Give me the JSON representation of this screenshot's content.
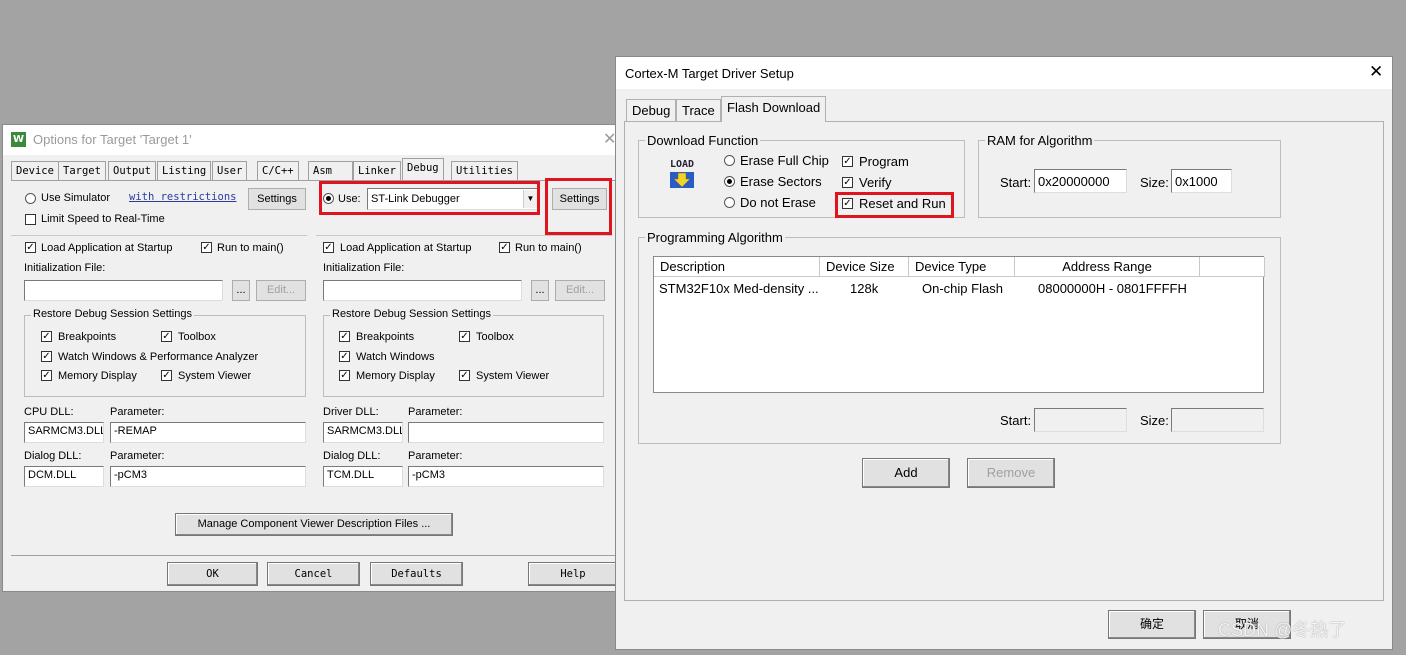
{
  "options_dialog": {
    "title": "Options for Target 'Target 1'",
    "close": "✕",
    "app_icon": "W",
    "tabs": [
      "Device",
      "Target",
      "Output",
      "Listing",
      "User",
      "C/C++",
      "Asm",
      "Linker",
      "Debug",
      "Utilities"
    ],
    "active_tab": "Debug",
    "left": {
      "use_simulator": "Use Simulator",
      "with_restrictions": "with restrictions",
      "settings": "Settings",
      "limit_speed": "Limit Speed to Real-Time",
      "load_app": "Load Application at Startup",
      "run_to_main": "Run to main()",
      "init_file": "Initialization File:",
      "browse": "...",
      "edit": "Edit...",
      "restore_group": "Restore Debug Session Settings",
      "breakpoints": "Breakpoints",
      "toolbox": "Toolbox",
      "watch_windows": "Watch Windows & Performance Analyzer",
      "memory_display": "Memory Display",
      "system_viewer": "System Viewer",
      "cpu_dll": "CPU DLL:",
      "parameter": "Parameter:",
      "cpu_dll_value": "SARMCM3.DLL",
      "cpu_param_value": "-REMAP",
      "dialog_dll": "Dialog DLL:",
      "dialog_dll_value": "DCM.DLL",
      "dialog_param_value": "-pCM3"
    },
    "right": {
      "use": "Use:",
      "debugger": "ST-Link Debugger",
      "settings": "Settings",
      "load_app": "Load Application at Startup",
      "run_to_main": "Run to main()",
      "init_file": "Initialization File:",
      "browse": "...",
      "edit": "Edit...",
      "restore_group": "Restore Debug Session Settings",
      "breakpoints": "Breakpoints",
      "toolbox": "Toolbox",
      "watch_windows": "Watch Windows",
      "memory_display": "Memory Display",
      "system_viewer": "System Viewer",
      "driver_dll": "Driver DLL:",
      "parameter": "Parameter:",
      "driver_dll_value": "SARMCM3.DLL",
      "driver_param_value": "",
      "dialog_dll": "Dialog DLL:",
      "dialog_dll_value": "TCM.DLL",
      "dialog_param_value": "-pCM3"
    },
    "manage_button": "Manage Component Viewer Description Files ...",
    "ok": "OK",
    "cancel": "Cancel",
    "defaults": "Defaults",
    "help": "Help"
  },
  "cortex_dialog": {
    "title": "Cortex-M Target Driver Setup",
    "close": "✕",
    "tabs": [
      "Debug",
      "Trace",
      "Flash Download"
    ],
    "active_tab": "Flash Download",
    "download_function": {
      "group": "Download Function",
      "load_icon_text": "LOAD",
      "erase_full_chip": "Erase Full Chip",
      "erase_sectors": "Erase Sectors",
      "do_not_erase": "Do not Erase",
      "selected": "Erase Sectors",
      "program": "Program",
      "verify": "Verify",
      "reset_and_run": "Reset and Run"
    },
    "ram": {
      "group": "RAM for Algorithm",
      "start_label": "Start:",
      "start_value": "0x20000000",
      "size_label": "Size:",
      "size_value": "0x1000"
    },
    "programming_algorithm": {
      "group": "Programming Algorithm",
      "columns": [
        "Description",
        "Device Size",
        "Device Type",
        "Address Range"
      ],
      "rows": [
        [
          "STM32F10x Med-density ...",
          "128k",
          "On-chip Flash",
          "08000000H - 0801FFFFH"
        ]
      ],
      "start_label": "Start:",
      "size_label": "Size:",
      "start_value": "",
      "size_value": ""
    },
    "add": "Add",
    "remove": "Remove",
    "ok": "确定",
    "cancel": "取消"
  },
  "watermark": "CSDN @冬热了",
  "colors": {
    "highlight": "#e0141e",
    "dialog_bg": "#f0f0f0",
    "desktop": "#a3a3a3"
  }
}
